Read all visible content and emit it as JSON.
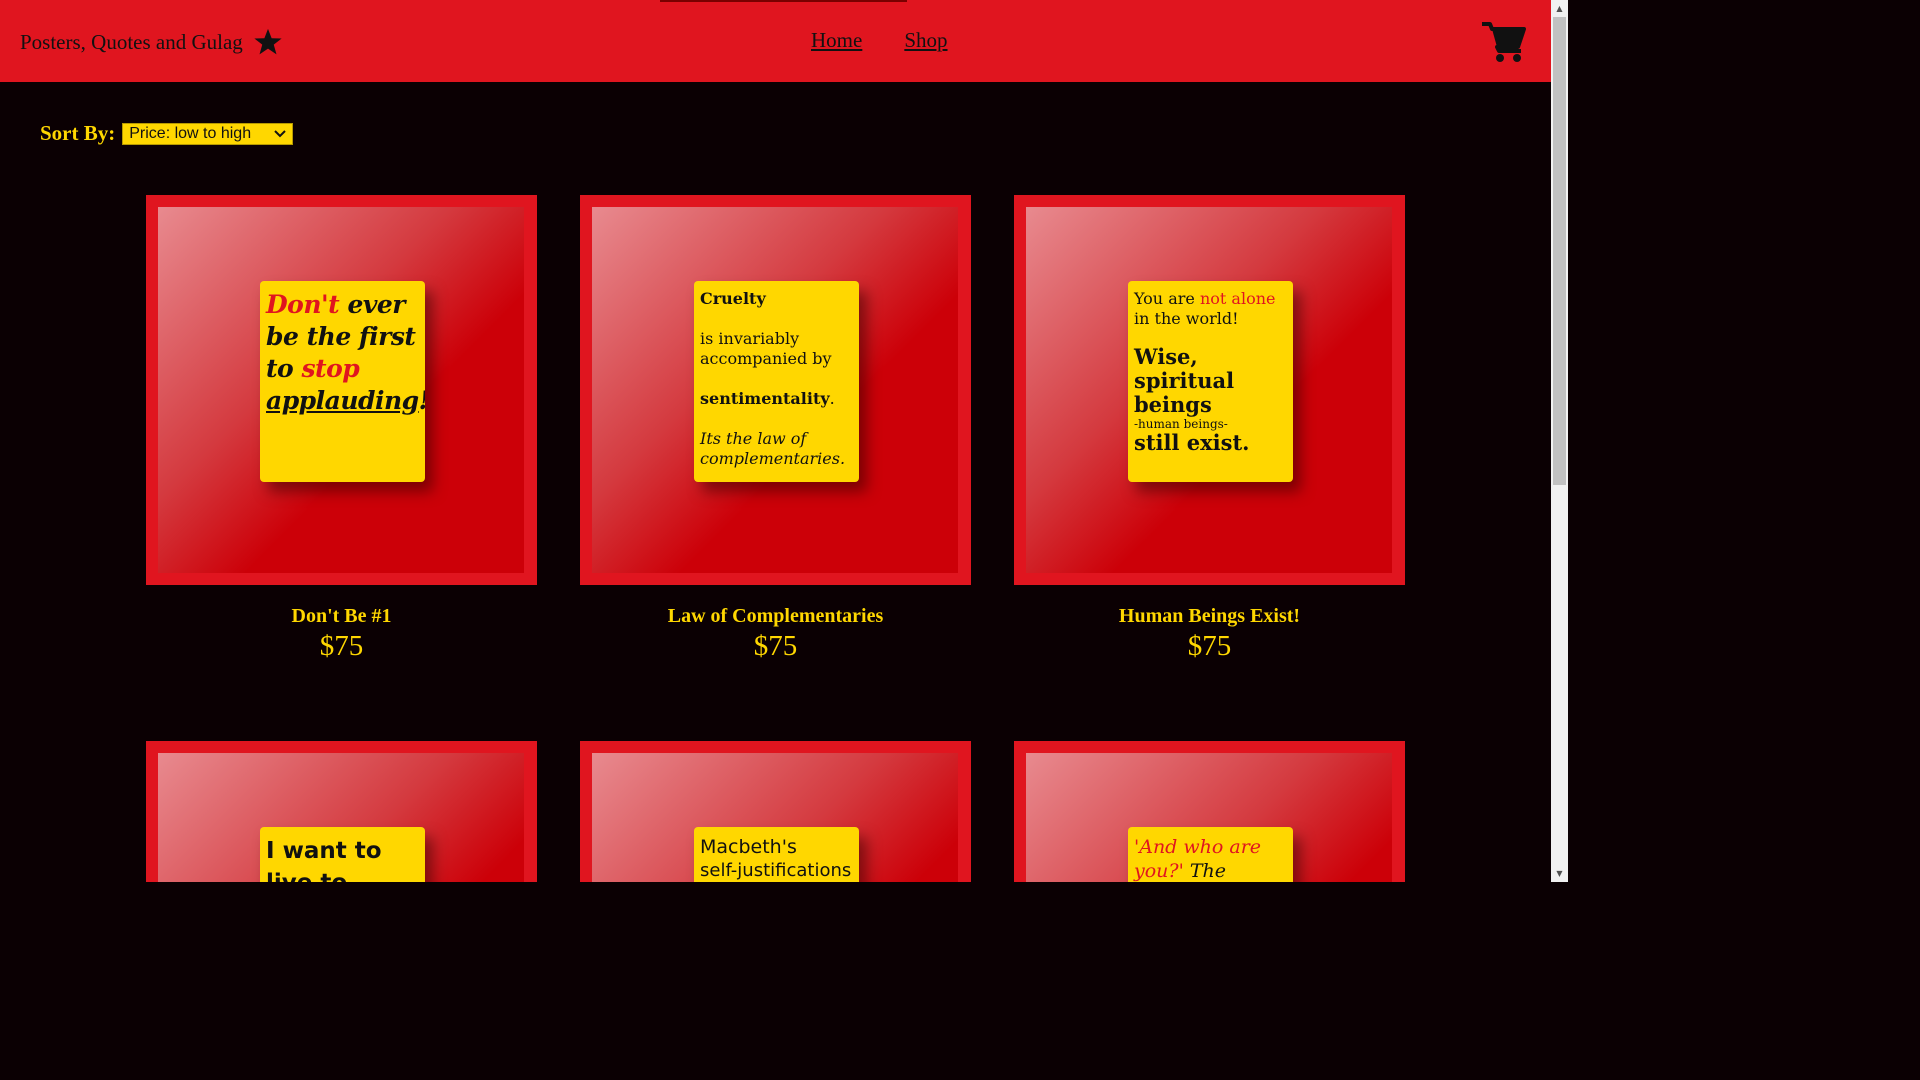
{
  "header": {
    "brand": "Posters, Quotes and Gulag",
    "nav": [
      "Home",
      "Shop"
    ]
  },
  "sort": {
    "label": "Sort By:",
    "selected": "Price: low to high"
  },
  "products": [
    {
      "name": "Don't Be #1",
      "price": "$75",
      "poster": {
        "w1": "Don't",
        "w2": "ever",
        "w3": "be the first",
        "w4": "to",
        "w5": "stop",
        "w6": "applauding",
        "w7": "!"
      }
    },
    {
      "name": "Law of Complementaries",
      "price": "$75",
      "poster": {
        "l1": "Cruelty",
        "l2": "is invariably accompanied by",
        "l3": "sentimentality",
        "l3b": ".",
        "l4": "Its the law of complementaries."
      }
    },
    {
      "name": "Human Beings Exist!",
      "price": "$75",
      "poster": {
        "l1a": "You are",
        "l1b": "not alone",
        "l2": "in the world!",
        "l3": "Wise, spiritual beings",
        "l4": "-human beings-",
        "l5": "still exist",
        "l5b": "."
      }
    },
    {
      "poster": {
        "l1": "I want to",
        "l2": "live to..."
      }
    },
    {
      "poster": {
        "l1": "Macbeth's",
        "l2": "self-justifications"
      }
    },
    {
      "poster": {
        "l1": "'And who are",
        "l2a": "you?'",
        "l2b": "The"
      }
    }
  ],
  "colors": {
    "header_bg": "#e0151f",
    "page_bg": "#0b0003",
    "accent_yellow": "#ffd700"
  },
  "icons": [
    "star-icon",
    "cart-icon",
    "chevron-down-icon"
  ]
}
